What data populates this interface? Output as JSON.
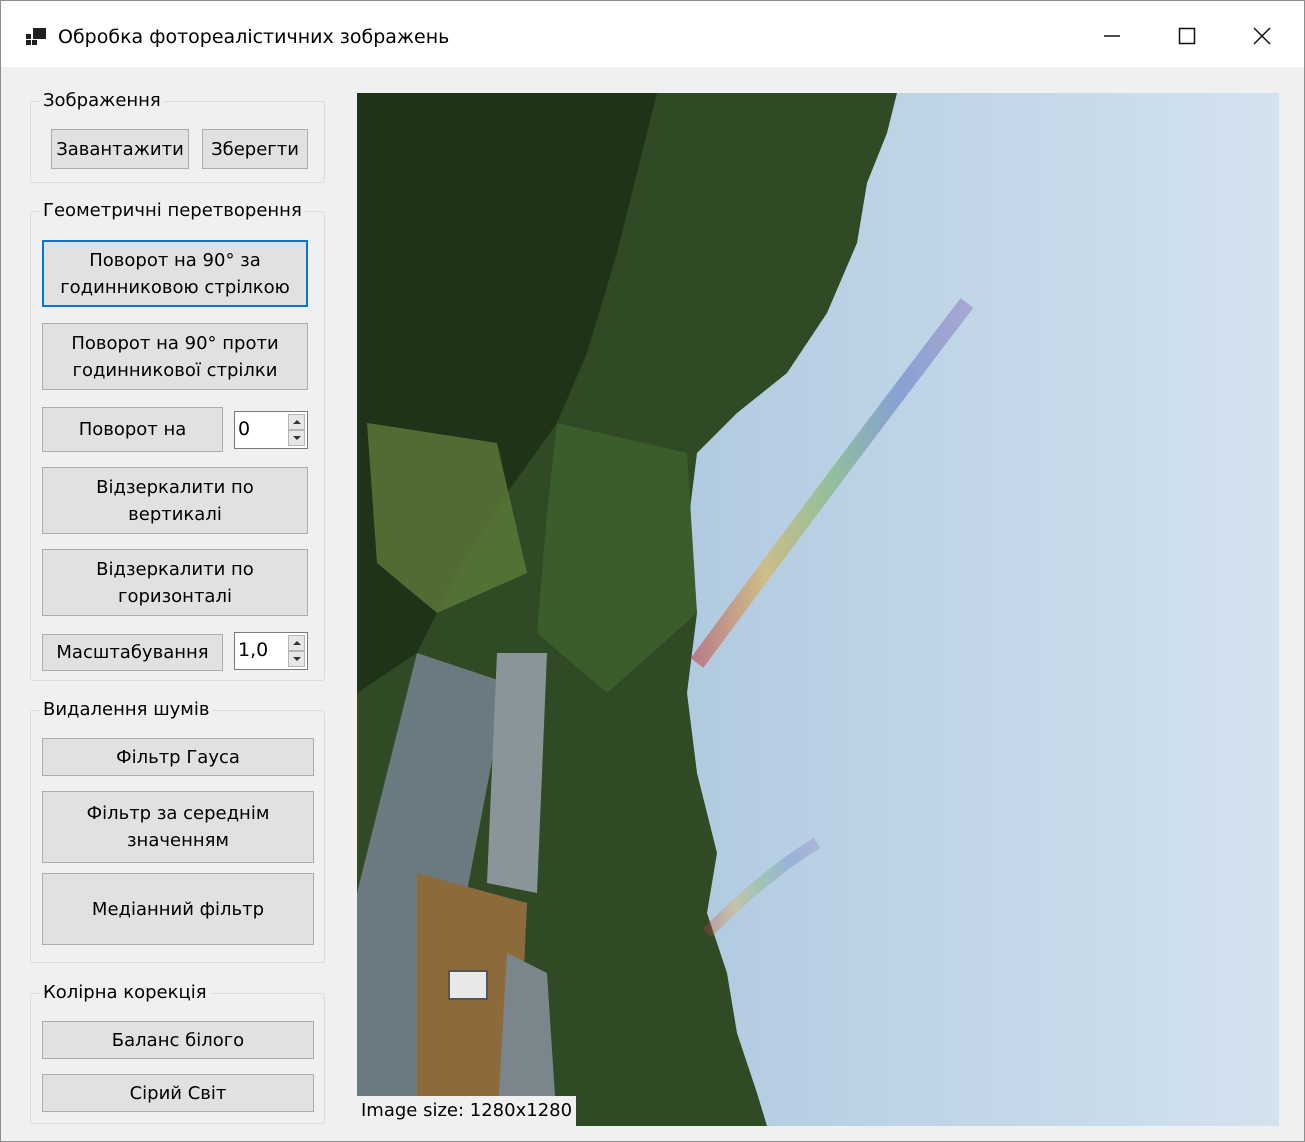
{
  "window": {
    "title": "Обробка фотореалістичних зображень",
    "icon": "app-window-icon",
    "controls": [
      "minimize-icon",
      "maximize-icon",
      "close-icon"
    ]
  },
  "groups": {
    "image": {
      "label": "Зображення",
      "load_label": "Завантажити",
      "save_label": "Зберегти"
    },
    "geometry": {
      "label": "Геометричні перетворення",
      "rotate_cw_label": "Поворот на 90° за\nгодинниковою стрілкою",
      "rotate_ccw_label": "Поворот на 90° проти\nгодинникової стрілки",
      "rotate_by_label": "Поворот на",
      "rotate_value": "0",
      "mirror_vertical_label": "Відзеркалити по вертикалі",
      "mirror_horizontal_label": "Відзеркалити по\nгоризонталі",
      "scale_label": "Масштабування",
      "scale_value": "1,0"
    },
    "denoise": {
      "label": "Видалення шумів",
      "gauss_label": "Фільтр Гауса",
      "mean_label": "Фільтр за середнім\nзначенням",
      "median_label": "Медіанний фільтр"
    },
    "color": {
      "label": "Колірна корекція",
      "white_balance_label": "Баланс білого",
      "gray_world_label": "Сірий Світ"
    }
  },
  "image_view": {
    "description_icon": "photo-rainbow-landscape",
    "size_text": "Image size: 1280x1280"
  },
  "colors": {
    "focus_border": "#0078d7",
    "button_face": "#e1e1e1",
    "window_bg": "#f0f0f0"
  }
}
